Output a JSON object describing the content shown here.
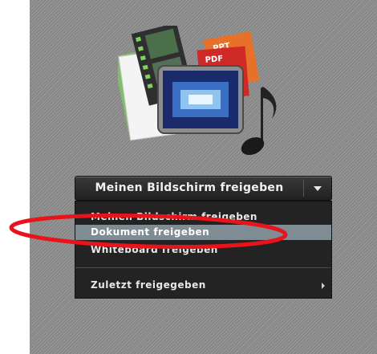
{
  "share_button": {
    "label": "Meinen Bildschirm freigeben",
    "dropdown_icon": "chevron-down-icon"
  },
  "menu": {
    "items": [
      {
        "label": "Meinen Bildschirm freigeben"
      },
      {
        "label": "Dokument freigeben",
        "highlighted": true
      },
      {
        "label": "Whiteboard freigeben"
      },
      {
        "label": "Zuletzt freigegeben",
        "submenu_icon": "chevron-right-icon"
      }
    ]
  },
  "illustration": {
    "doc_labels": [
      "PPT",
      "PDF"
    ],
    "icons": [
      "film-strip-icon",
      "monitor-icon",
      "music-note-icon"
    ]
  },
  "annotation": {
    "shape": "ellipse",
    "color": "#e8141b"
  },
  "colors": {
    "menu_bg": "#232323",
    "highlight": "#7f8c94",
    "panel_bg": "#8f8f8f"
  }
}
